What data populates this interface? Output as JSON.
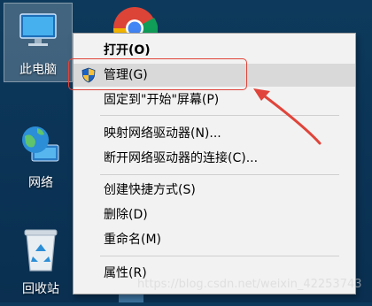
{
  "desktop": {
    "icons": [
      {
        "label": "此电脑",
        "icon": "computer-icon"
      },
      {
        "label": "网络",
        "icon": "network-globe-icon"
      },
      {
        "label": "回收站",
        "icon": "recycle-bin-icon"
      },
      {
        "label": "",
        "icon": "chrome-icon"
      },
      {
        "label": "",
        "icon": "partial-icon"
      }
    ]
  },
  "context_menu": {
    "items": [
      {
        "label": "打开(O)",
        "bold": true
      },
      {
        "label": "管理(G)",
        "icon": "uac-shield-icon",
        "highlighted": true
      },
      {
        "label": "固定到\"开始\"屏幕(P)"
      },
      {
        "label": "映射网络驱动器(N)..."
      },
      {
        "label": "断开网络驱动器的连接(C)..."
      },
      {
        "label": "创建快捷方式(S)"
      },
      {
        "label": "删除(D)"
      },
      {
        "label": "重命名(M)"
      },
      {
        "label": "属性(R)"
      }
    ]
  },
  "annotation": {
    "color": "#e0443a"
  },
  "watermark": "https://blog.csdn.net/weixin_42253743"
}
